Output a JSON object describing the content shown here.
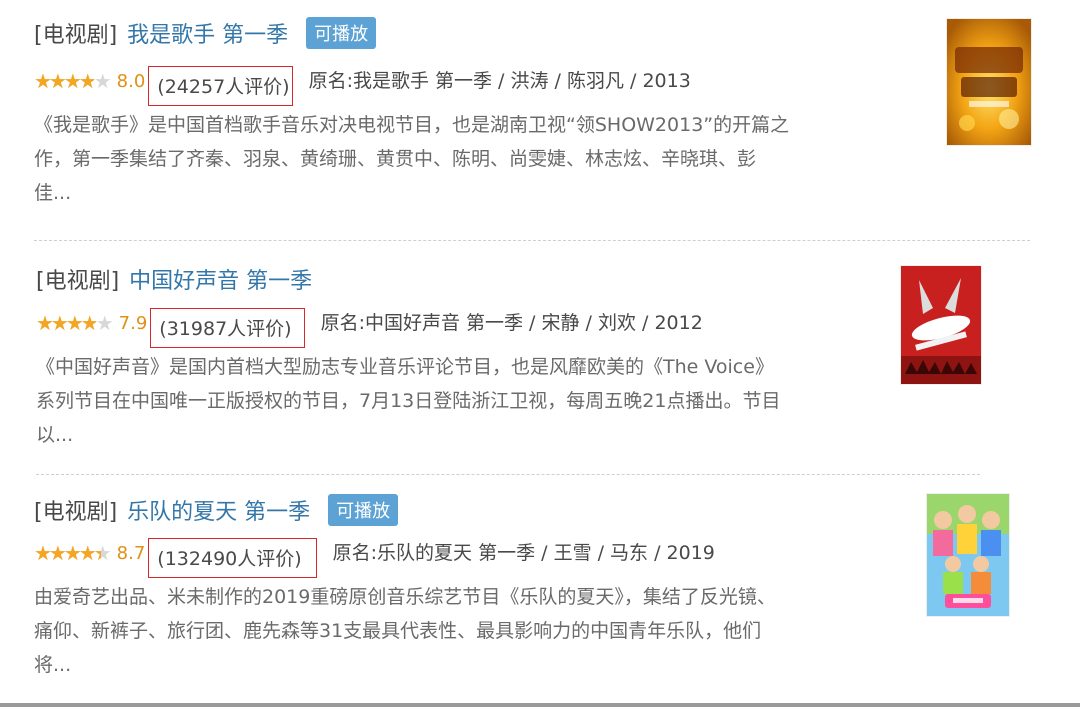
{
  "items": [
    {
      "category": "[电视剧]",
      "title": "我是歌手 第一季",
      "badge": "可播放",
      "rating_fraction": 0.8,
      "score": "8.0",
      "count": "(24257人评价)",
      "original": "原名:我是歌手 第一季 / 洪涛 / 陈羽凡 / 2013",
      "desc": [
        "《我是歌手》是中国首档歌手音乐对决电视节目，也是湖南卫视“领SHOW2013”的开篇之",
        "作，第一季集结了齐秦、羽泉、黄绮珊、黄贯中、陈明、尚雯婕、林志炫、辛晓琪、彭",
        "佳..."
      ]
    },
    {
      "category": "[电视剧]",
      "title": "中国好声音 第一季",
      "badge": "",
      "rating_fraction": 0.8,
      "score": "7.9",
      "count": "(31987人评价)",
      "original": "原名:中国好声音 第一季 / 宋静 / 刘欢 / 2012",
      "desc": [
        "《中国好声音》是国内首档大型励志专业音乐评论节目，也是风靡欧美的《The Voice》",
        "系列节目在中国唯一正版授权的节目，7月13日登陆浙江卫视，每周五晚21点播出。节目",
        "以..."
      ]
    },
    {
      "category": "[电视剧]",
      "title": "乐队的夏天 第一季",
      "badge": "可播放",
      "rating_fraction": 0.9,
      "score": "8.7",
      "count": "(132490人评价)",
      "original": "原名:乐队的夏天 第一季 / 王雪 / 马东 / 2019",
      "desc": [
        "由爱奇艺出品、米未制作的2019重磅原创音乐综艺节目《乐队的夏天》，集结了反光镜、",
        "痛仰、新裤子、旅行团、鹿先森等31支最具代表性、最具影响力的中国青年乐队，他们",
        "将..."
      ]
    }
  ],
  "stars_glyph": "★★★★★",
  "colors": {
    "link": "#3377aa",
    "star": "#f4a622",
    "badge": "#5ca2d4",
    "highlight_box": "#d9272e"
  }
}
